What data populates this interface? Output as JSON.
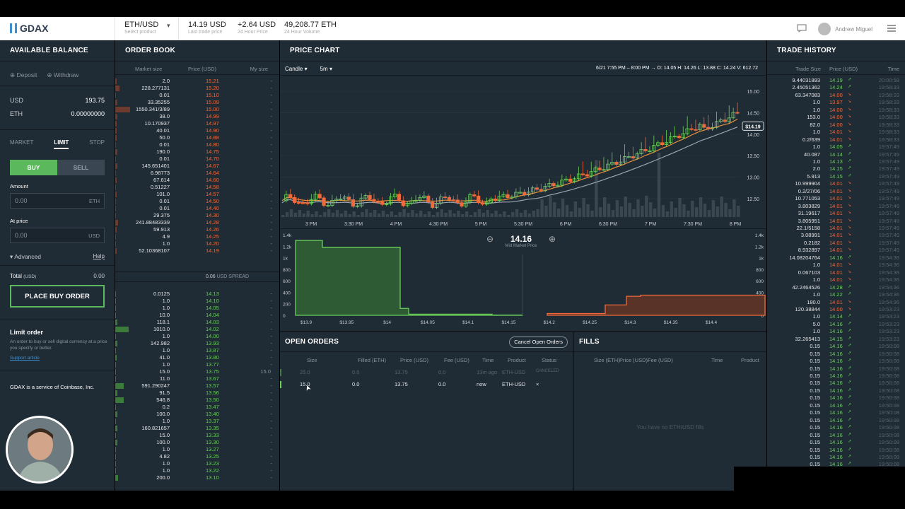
{
  "header": {
    "logo": "GDAX",
    "product": "ETH/USD",
    "product_sub": "Select product",
    "last_price": "14.19 USD",
    "last_price_sub": "Last trade price",
    "change": "+2.64 USD",
    "change_sub": "24 Hour Price",
    "volume": "49,208.77 ETH",
    "volume_sub": "24 Hour Volume",
    "user_name": "Andrew Miguel"
  },
  "left": {
    "title": "AVAILABLE BALANCE",
    "deposit": "Deposit",
    "withdraw": "Withdraw",
    "usd_label": "USD",
    "usd_value": "193.75",
    "eth_label": "ETH",
    "eth_value": "0.00000000",
    "tab_market": "MARKET",
    "tab_limit": "LIMIT",
    "tab_stop": "STOP",
    "buy": "BUY",
    "sell": "SELL",
    "amount_label": "Amount",
    "amount_value": "0.00",
    "amount_unit": "ETH",
    "price_label": "At price",
    "price_value": "0.00",
    "price_unit": "USD",
    "advanced": "Advanced",
    "help": "Help",
    "total_label": "Total",
    "total_unit": "(USD)",
    "total_value": "0.00",
    "place_order": "PLACE BUY ORDER",
    "info_title": "Limit order",
    "info_text": "An order to buy or sell digital currency at a price you specify or better.",
    "support": "Support article",
    "footer": "GDAX is a service of Coinbase, Inc."
  },
  "orderbook": {
    "title": "ORDER BOOK",
    "col_size": "Market size",
    "col_price": "Price (USD)",
    "col_my": "My size",
    "spread_value": "0.06",
    "spread_label": "USD SPREAD",
    "asks": [
      {
        "size": "2.0",
        "price": "15.21",
        "bar": 2
      },
      {
        "size": "228.277131",
        "price": "15.20",
        "bar": 6
      },
      {
        "size": "0.01",
        "price": "15.10",
        "bar": 1
      },
      {
        "size": "33.35255",
        "price": "15.09",
        "bar": 3
      },
      {
        "size": "1550.341/3/89",
        "price": "15.00",
        "bar": 21
      },
      {
        "size": "38.0",
        "price": "14.99",
        "bar": 3
      },
      {
        "size": "10.170937",
        "price": "14.97",
        "bar": 2
      },
      {
        "size": "40.01",
        "price": "14.90",
        "bar": 2
      },
      {
        "size": "50.0",
        "price": "14.88",
        "bar": 2
      },
      {
        "size": "0.01",
        "price": "14.80",
        "bar": 1
      },
      {
        "size": "190.0",
        "price": "14.75",
        "bar": 3
      },
      {
        "size": "0.01",
        "price": "14.70",
        "bar": 1
      },
      {
        "size": "145.651401",
        "price": "14.67",
        "bar": 3
      },
      {
        "size": "6.98773",
        "price": "14.64",
        "bar": 1
      },
      {
        "size": "67.614",
        "price": "14.60",
        "bar": 2
      },
      {
        "size": "0.51227",
        "price": "14.58",
        "bar": 1
      },
      {
        "size": "101.0",
        "price": "14.57",
        "bar": 2
      },
      {
        "size": "0.01",
        "price": "14.50",
        "bar": 1
      },
      {
        "size": "0.01",
        "price": "14.40",
        "bar": 1
      },
      {
        "size": "29.375",
        "price": "14.30",
        "bar": 1
      },
      {
        "size": "241.88483339",
        "price": "14.28",
        "bar": 4
      },
      {
        "size": "59.913",
        "price": "14.26",
        "bar": 2
      },
      {
        "size": "4.9",
        "price": "14.25",
        "bar": 1
      },
      {
        "size": "1.0",
        "price": "14.20",
        "bar": 1
      },
      {
        "size": "52.10368107",
        "price": "14.19",
        "bar": 2
      }
    ],
    "bids": [
      {
        "size": "0.0125",
        "price": "14.13",
        "bar": 1
      },
      {
        "size": "1.0",
        "price": "14.10",
        "bar": 1
      },
      {
        "size": "1.0",
        "price": "14.05",
        "bar": 1
      },
      {
        "size": "10.0",
        "price": "14.04",
        "bar": 1
      },
      {
        "size": "118.1",
        "price": "14.03",
        "bar": 3
      },
      {
        "size": "1010.0",
        "price": "14.02",
        "bar": 19
      },
      {
        "size": "1.0",
        "price": "14.00",
        "bar": 1
      },
      {
        "size": "142.982",
        "price": "13.93",
        "bar": 3
      },
      {
        "size": "1.0",
        "price": "13.87",
        "bar": 1
      },
      {
        "size": "41.0",
        "price": "13.80",
        "bar": 2
      },
      {
        "size": "1.0",
        "price": "13.77",
        "bar": 1
      },
      {
        "size": "15.0",
        "price": "13.75",
        "bar": 1,
        "my": "15.0"
      },
      {
        "size": "11.0",
        "price": "13.67",
        "bar": 1
      },
      {
        "size": "591.290247",
        "price": "13.57",
        "bar": 12
      },
      {
        "size": "91.5",
        "price": "13.56",
        "bar": 3
      },
      {
        "size": "546.8",
        "price": "13.50",
        "bar": 12
      },
      {
        "size": "0.2",
        "price": "13.47",
        "bar": 1
      },
      {
        "size": "100.0",
        "price": "13.40",
        "bar": 3
      },
      {
        "size": "1.0",
        "price": "13.37",
        "bar": 1
      },
      {
        "size": "160.821657",
        "price": "13.35",
        "bar": 3
      },
      {
        "size": "15.0",
        "price": "13.33",
        "bar": 1
      },
      {
        "size": "100.0",
        "price": "13.30",
        "bar": 3
      },
      {
        "size": "1.0",
        "price": "13.27",
        "bar": 1
      },
      {
        "size": "4.82",
        "price": "13.25",
        "bar": 1
      },
      {
        "size": "1.0",
        "price": "13.23",
        "bar": 1
      },
      {
        "size": "1.0",
        "price": "13.22",
        "bar": 1
      },
      {
        "size": "200.0",
        "price": "13.10",
        "bar": 4
      }
    ]
  },
  "chart": {
    "title": "PRICE CHART",
    "type_sel": "Candle",
    "interval_sel": "5m",
    "ohlc": "6/21 7:55 PM – 8:00 PM → O: 14.05   H: 14.26   L: 13.88   C: 14.24   V: 612.72",
    "price_ticks": [
      "15.00",
      "14.50",
      "14.00",
      "13.50",
      "13.00",
      "12.50"
    ],
    "current_price": "$14.19",
    "time_ticks": [
      "3 PM",
      "3:30 PM",
      "4 PM",
      "4:30 PM",
      "5 PM",
      "5:30 PM",
      "6 PM",
      "6:30 PM",
      "7 PM",
      "7:30 PM",
      "8 PM"
    ],
    "mid_price": "14.16",
    "mid_label": "Mid Market Price",
    "depth_y_left": [
      "1.4k",
      "1.2k",
      "1k",
      "800",
      "600",
      "400",
      "200",
      "0"
    ],
    "depth_y_right": [
      "1.4k",
      "1.2k",
      "1k",
      "800",
      "600",
      "400",
      "200",
      "0"
    ],
    "depth_x": [
      "$13.9",
      "$13.95",
      "$14",
      "$14.05",
      "$14.1",
      "$14.15",
      "$14.2",
      "$14.25",
      "$14.3",
      "$14.35",
      "$14.4"
    ]
  },
  "open_orders": {
    "title": "OPEN ORDERS",
    "cancel_btn": "Cancel Open Orders",
    "cols": [
      "Size",
      "Filled (ETH)",
      "Price (USD)",
      "Fee (USD)",
      "Time",
      "Product",
      "Status"
    ],
    "rows": [
      {
        "size": "25.0",
        "filled": "0.0",
        "price": "13.75",
        "fee": "0.0",
        "time": "13m ago",
        "product": "ETH-USD",
        "status": "CANCELED"
      },
      {
        "size": "15.0",
        "filled": "0.0",
        "price": "13.75",
        "fee": "0.0",
        "time": "now",
        "product": "ETH-USD",
        "status": "×"
      }
    ]
  },
  "fills": {
    "title": "FILLS",
    "cols": [
      "Size (ETH)",
      "Price (USD)",
      "Fee (USD)",
      "Time",
      "Product"
    ],
    "empty": "You have no ETH/USD fills"
  },
  "trades": {
    "title": "TRADE HISTORY",
    "col_size": "Trade Size",
    "col_price": "Price (USD)",
    "col_time": "Time",
    "rows": [
      {
        "size": "9.44031893",
        "price": "14.19",
        "side": "up",
        "time": "20:00:58"
      },
      {
        "size": "2.45051362",
        "price": "14.24",
        "side": "up",
        "time": "19:58:33"
      },
      {
        "size": "63.347083",
        "price": "14.00",
        "side": "down",
        "time": "19:58:33"
      },
      {
        "size": "1.0",
        "price": "13.97",
        "side": "down",
        "time": "19:58:33"
      },
      {
        "size": "1.0",
        "price": "14.00",
        "side": "down",
        "time": "19:58:33"
      },
      {
        "size": "153.0",
        "price": "14.00",
        "side": "down",
        "time": "19:58:33"
      },
      {
        "size": "82.0",
        "price": "14.00",
        "side": "down",
        "time": "19:58:33"
      },
      {
        "size": "1.0",
        "price": "14.01",
        "side": "down",
        "time": "19:58:33"
      },
      {
        "size": "0.2/639",
        "price": "14.01",
        "side": "down",
        "time": "19:58:33"
      },
      {
        "size": "1.0",
        "price": "14.05",
        "side": "up",
        "time": "19:57:49"
      },
      {
        "size": "40.087",
        "price": "14.14",
        "side": "up",
        "time": "19:57:49"
      },
      {
        "size": "1.0",
        "price": "14.13",
        "side": "up",
        "time": "19:57:49"
      },
      {
        "size": "2.0",
        "price": "14.15",
        "side": "up",
        "time": "19:57:49"
      },
      {
        "size": "5.913",
        "price": "14.15",
        "side": "up",
        "time": "19:57:49"
      },
      {
        "size": "10.999904",
        "price": "14.01",
        "side": "down",
        "time": "19:57:49"
      },
      {
        "size": "0.2/27/06",
        "price": "14.01",
        "side": "down",
        "time": "19:57:49"
      },
      {
        "size": "10.771053",
        "price": "14.01",
        "side": "down",
        "time": "19:57:49"
      },
      {
        "size": "3.803829",
        "price": "14.01",
        "side": "down",
        "time": "19:57:49"
      },
      {
        "size": "31.19617",
        "price": "14.01",
        "side": "down",
        "time": "19:57:49"
      },
      {
        "size": "3.805951",
        "price": "14.01",
        "side": "down",
        "time": "19:57:49"
      },
      {
        "size": "22.1/5158",
        "price": "14.01",
        "side": "down",
        "time": "19:57:49"
      },
      {
        "size": "3.08991",
        "price": "14.01",
        "side": "down",
        "time": "19:57:49"
      },
      {
        "size": "0.2182",
        "price": "14.01",
        "side": "down",
        "time": "19:57:49"
      },
      {
        "size": "8.932897",
        "price": "14.01",
        "side": "down",
        "time": "19:57:49"
      },
      {
        "size": "14.08204764",
        "price": "14.16",
        "side": "up",
        "time": "19:54:36"
      },
      {
        "size": "1.0",
        "price": "14.01",
        "side": "down",
        "time": "19:54:36"
      },
      {
        "size": "0.067103",
        "price": "14.01",
        "side": "down",
        "time": "19:54:36"
      },
      {
        "size": "1.0",
        "price": "14.01",
        "side": "down",
        "time": "19:54:36"
      },
      {
        "size": "42.2464526",
        "price": "14.28",
        "side": "up",
        "time": "19:54:36"
      },
      {
        "size": "1.0",
        "price": "14.22",
        "side": "up",
        "time": "19:54:36"
      },
      {
        "size": "180.0",
        "price": "14.01",
        "side": "down",
        "time": "19:54:36"
      },
      {
        "size": "120.38844",
        "price": "14.00",
        "side": "down",
        "time": "19:53:23"
      },
      {
        "size": "1.0",
        "price": "14.14",
        "side": "up",
        "time": "19:53:23"
      },
      {
        "size": "5.0",
        "price": "14.16",
        "side": "up",
        "time": "19:53:23"
      },
      {
        "size": "1.0",
        "price": "14.16",
        "side": "up",
        "time": "19:53:23"
      },
      {
        "size": "32.265413",
        "price": "14.15",
        "side": "up",
        "time": "19:53:23"
      },
      {
        "size": "0.15",
        "price": "14.16",
        "side": "up",
        "time": "19:50:08"
      },
      {
        "size": "0.15",
        "price": "14.16",
        "side": "up",
        "time": "19:50:08"
      },
      {
        "size": "0.15",
        "price": "14.16",
        "side": "up",
        "time": "19:50:08"
      },
      {
        "size": "0.15",
        "price": "14.16",
        "side": "up",
        "time": "19:50:08"
      },
      {
        "size": "0.15",
        "price": "14.16",
        "side": "up",
        "time": "19:50:08"
      },
      {
        "size": "0.15",
        "price": "14.16",
        "side": "up",
        "time": "19:50:08"
      },
      {
        "size": "0.15",
        "price": "14.16",
        "side": "up",
        "time": "19:50:08"
      },
      {
        "size": "0.15",
        "price": "14.16",
        "side": "up",
        "time": "19:50:08"
      },
      {
        "size": "0.15",
        "price": "14.16",
        "side": "up",
        "time": "19:50:08"
      },
      {
        "size": "0.15",
        "price": "14.16",
        "side": "up",
        "time": "19:50:08"
      },
      {
        "size": "0.15",
        "price": "14.16",
        "side": "up",
        "time": "19:50:08"
      },
      {
        "size": "0.15",
        "price": "14.16",
        "side": "up",
        "time": "19:50:08"
      },
      {
        "size": "0.15",
        "price": "14.16",
        "side": "up",
        "time": "19:50:08"
      },
      {
        "size": "0.15",
        "price": "14.16",
        "side": "up",
        "time": "19:50:08"
      },
      {
        "size": "0.15",
        "price": "14.16",
        "side": "up",
        "time": "19:50:08"
      },
      {
        "size": "0.15",
        "price": "14.16",
        "side": "up",
        "time": "19:50:08"
      },
      {
        "size": "0.15",
        "price": "14.16",
        "side": "up",
        "time": "19:50:08"
      },
      {
        "size": "0.15",
        "price": "14.16",
        "side": "up",
        "time": "19:50:08"
      }
    ]
  },
  "colors": {
    "green": "#6ad15a",
    "red": "#f06b3c",
    "panel": "#1f2b35",
    "accent": "#5bb85c"
  }
}
